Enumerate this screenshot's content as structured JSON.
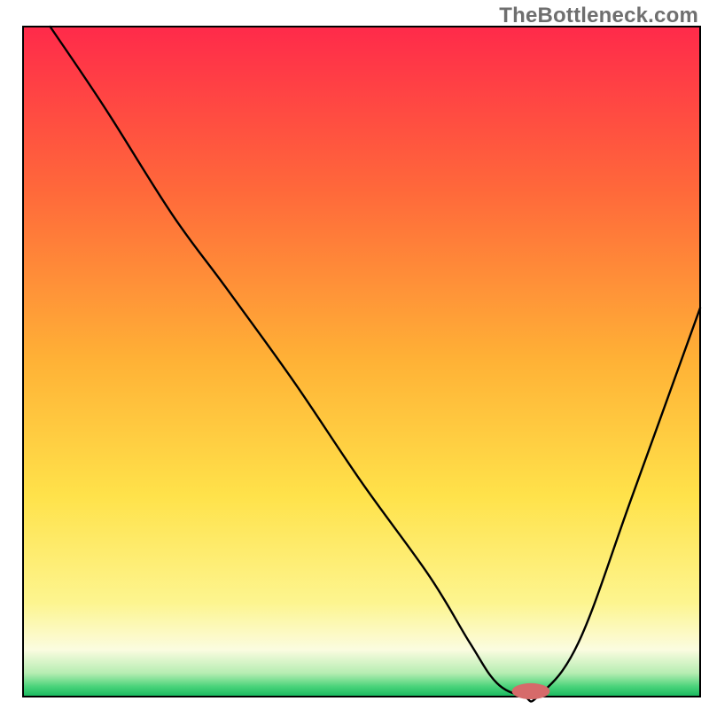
{
  "watermark": "TheBottleneck.com",
  "chart_data": {
    "type": "line",
    "title": "",
    "xlabel": "",
    "ylabel": "",
    "xlim": [
      0,
      100
    ],
    "ylim": [
      0,
      100
    ],
    "background_gradient": {
      "direction": "vertical",
      "stops": [
        {
          "t": 0.0,
          "color": "#ff2a4a"
        },
        {
          "t": 0.25,
          "color": "#ff6a3a"
        },
        {
          "t": 0.5,
          "color": "#ffb236"
        },
        {
          "t": 0.7,
          "color": "#ffe24a"
        },
        {
          "t": 0.86,
          "color": "#fdf58f"
        },
        {
          "t": 0.93,
          "color": "#fbfce0"
        },
        {
          "t": 0.965,
          "color": "#b6edb2"
        },
        {
          "t": 0.985,
          "color": "#4ad37a"
        },
        {
          "t": 1.0,
          "color": "#17b85e"
        }
      ]
    },
    "series": [
      {
        "name": "bottleneck-curve",
        "x": [
          4,
          12,
          22,
          30,
          40,
          50,
          60,
          66,
          70,
          74,
          76,
          82,
          90,
          100
        ],
        "y": [
          100,
          88,
          72,
          61,
          47,
          32,
          18,
          8,
          2,
          0,
          0,
          8,
          30,
          58
        ]
      }
    ],
    "marker": {
      "name": "optimal-range",
      "cx": 75,
      "cy": 0.8,
      "rx": 2.8,
      "ry": 1.2,
      "color": "#d66a6a"
    },
    "axes": {
      "show_ticks": false,
      "show_grid": false,
      "frame": true
    }
  }
}
